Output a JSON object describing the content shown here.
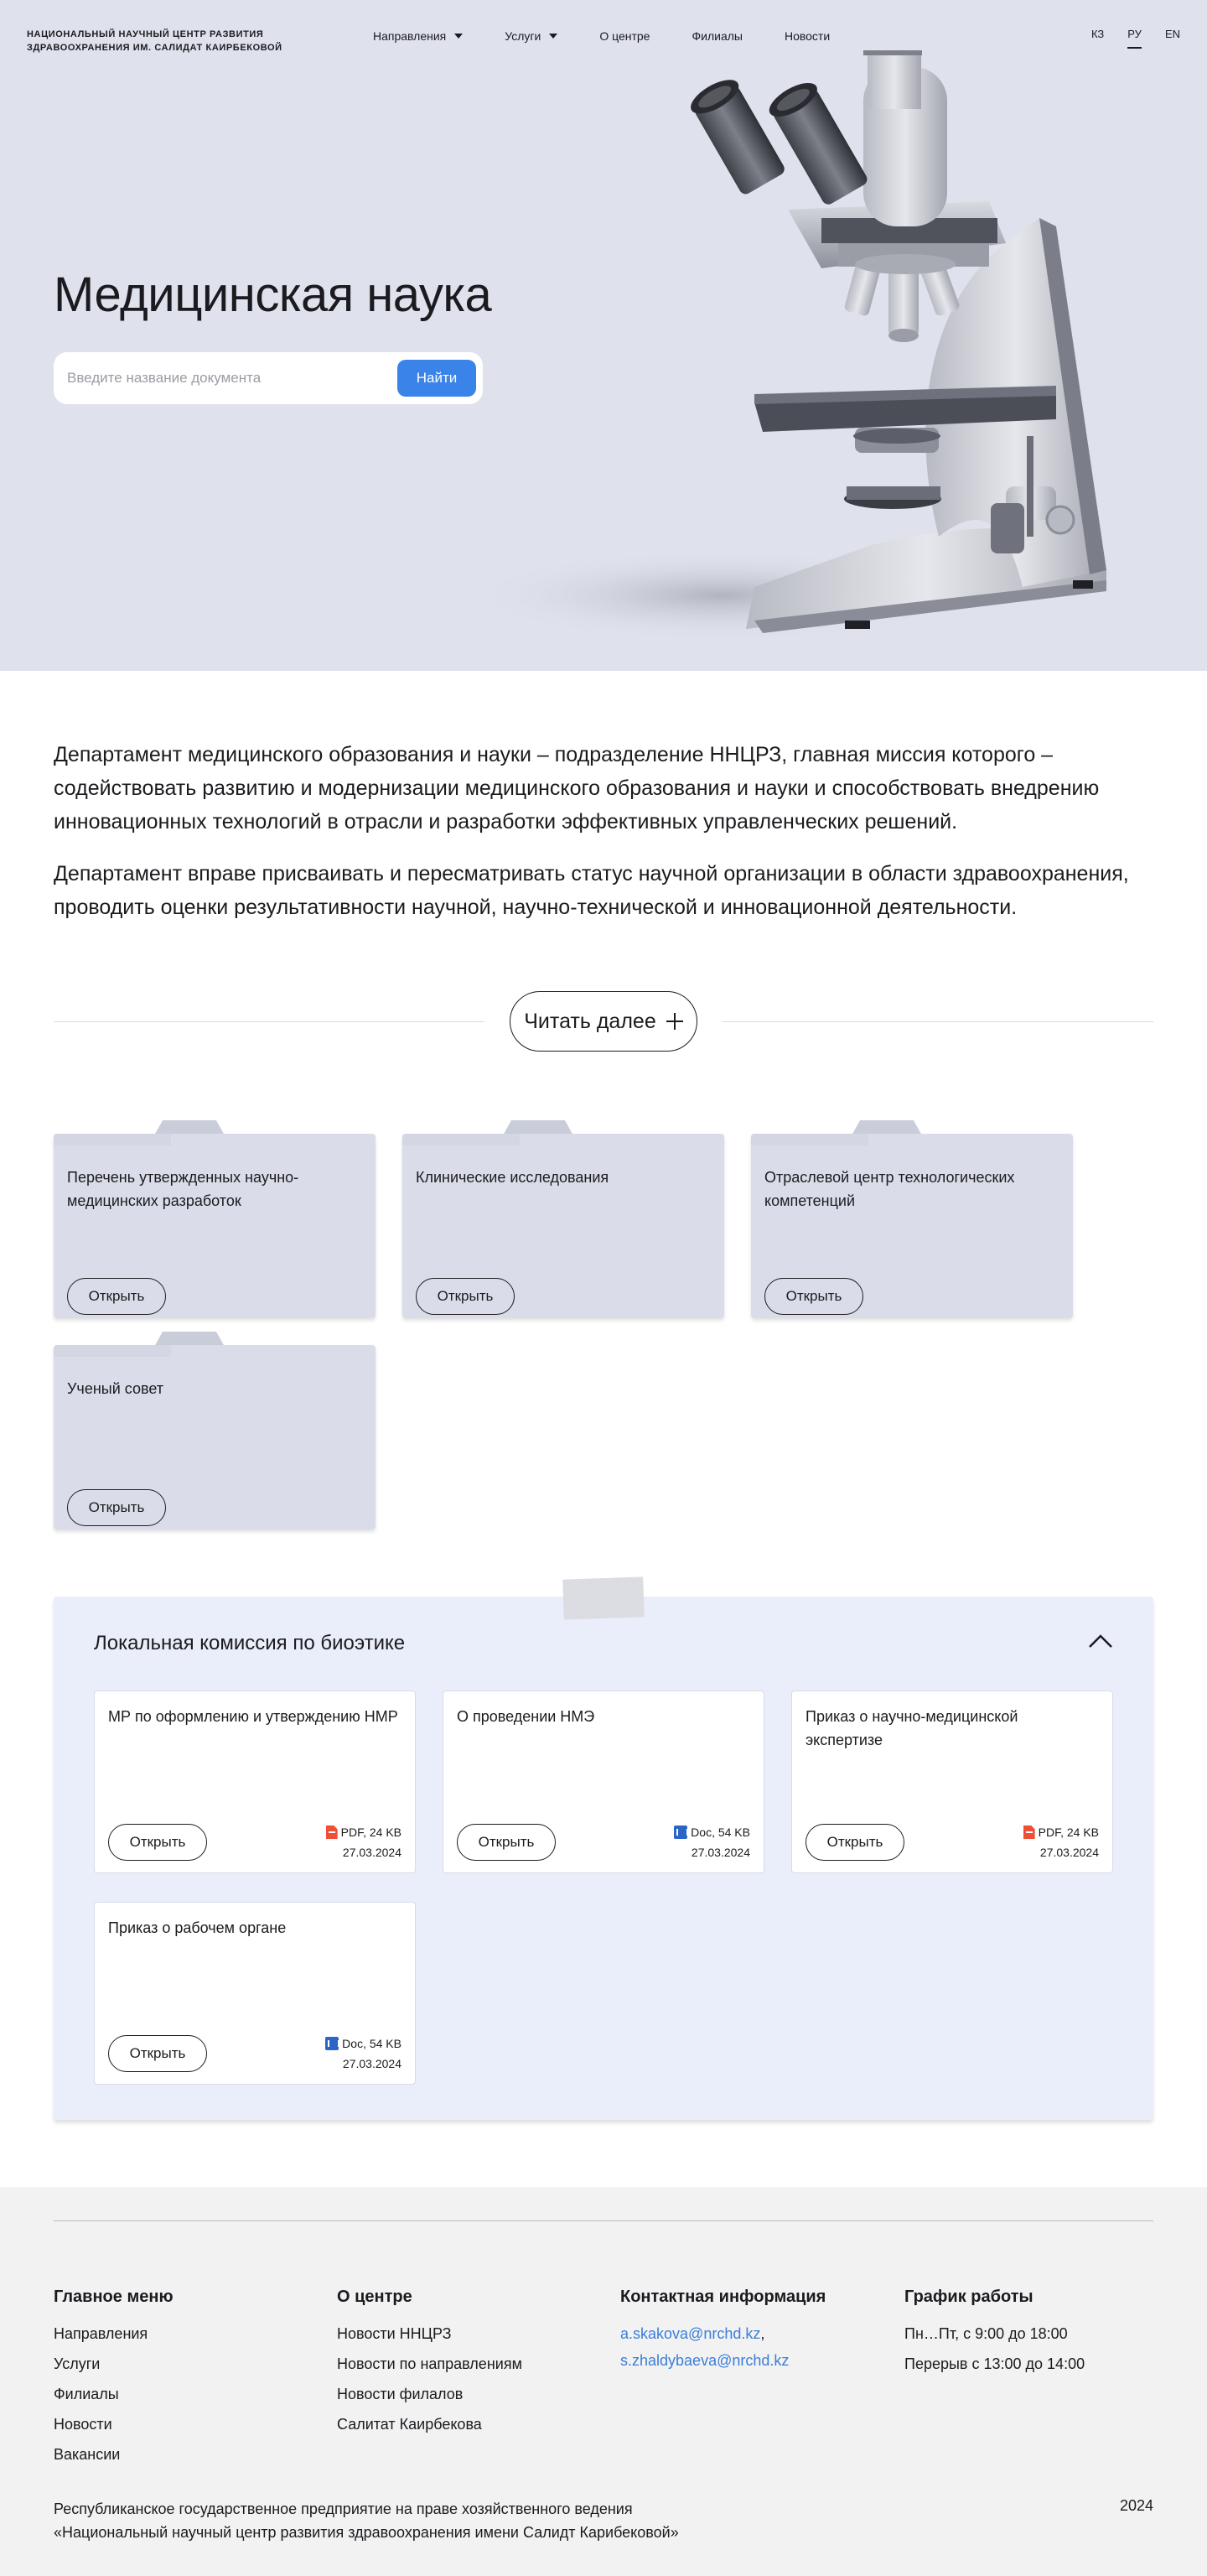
{
  "header": {
    "org_line1": "Национальный научный центр развития",
    "org_line2": "здравоохранения им. Салидат Каирбековой",
    "nav": [
      {
        "label": "Направления",
        "dropdown": true
      },
      {
        "label": "Услуги",
        "dropdown": true
      },
      {
        "label": "О центре",
        "dropdown": false
      },
      {
        "label": "Филиалы",
        "dropdown": false
      },
      {
        "label": "Новости",
        "dropdown": false
      }
    ],
    "languages": [
      "КЗ",
      "РУ",
      "EN"
    ],
    "active_language": "РУ"
  },
  "hero": {
    "title": "Медицинская наука",
    "search_placeholder": "Введите название документа",
    "search_button": "Найти",
    "illustration": "microscope"
  },
  "intro": {
    "paragraphs": [
      "Департамент медицинского образования и науки – подразделение ННЦРЗ, главная миссия которого – содействовать развитию и модернизации медицинского образования и науки и способствовать внедрению инновационных технологий в отрасли и разработки эффективных управленческих решений.",
      "Департамент вправе присваивать и пересматривать статус научной организации в области здравоохранения, проводить оценки результативности научной, научно-технической и инновационной деятельности."
    ],
    "read_more": "Читать далее"
  },
  "folders": [
    {
      "title": "Перечень утвержденных научно-медицинских разработок",
      "button": "Открыть"
    },
    {
      "title": "Клинические исследования",
      "button": "Открыть"
    },
    {
      "title": "Отраслевой центр технологических компетенций",
      "button": "Открыть"
    },
    {
      "title": "Ученый совет",
      "button": "Открыть"
    }
  ],
  "bioethics": {
    "title": "Локальная комиссия по биоэтике",
    "documents": [
      {
        "title": "МР по оформлению и утверждению НМР",
        "type": "pdf",
        "size": "PDF, 24 KB",
        "date": "27.03.2024",
        "button": "Открыть"
      },
      {
        "title": "О проведении НМЭ",
        "type": "doc",
        "size": "Doc, 54 KB",
        "date": "27.03.2024",
        "button": "Открыть"
      },
      {
        "title": "Приказ о научно-медицинской экспертизе",
        "type": "pdf",
        "size": "PDF, 24 KB",
        "date": "27.03.2024",
        "button": "Открыть"
      },
      {
        "title": "Приказ о рабочем органе",
        "type": "doc",
        "size": "Doc, 54 KB",
        "date": "27.03.2024",
        "button": "Открыть"
      }
    ]
  },
  "footer": {
    "main_menu": {
      "title": "Главное меню",
      "links": [
        "Направления",
        "Услуги",
        "Филиалы",
        "Новости",
        "Вакансии"
      ]
    },
    "about": {
      "title": "О центре",
      "links": [
        "Новости ННЦРЗ",
        "Новости по направлениям",
        "Новости филалов",
        "Салитат Каирбекова"
      ]
    },
    "contacts": {
      "title": "Контактная информация",
      "email1": "a.skakova@nrchd.kz",
      "separator": ",",
      "email2": "s.zhaldybaeva@nrchd.kz"
    },
    "schedule": {
      "title": "График работы",
      "line1": "Пн…Пт, с 9:00 до 18:00",
      "line2": "Перерыв с 13:00 до 14:00"
    },
    "legal_line1": "Республиканское государственное предприятие на праве хозяйственного ведения",
    "legal_line2": "«Национальный научный центр развития здравоохранения имени Салидт Карибековой»",
    "year": "2024"
  }
}
